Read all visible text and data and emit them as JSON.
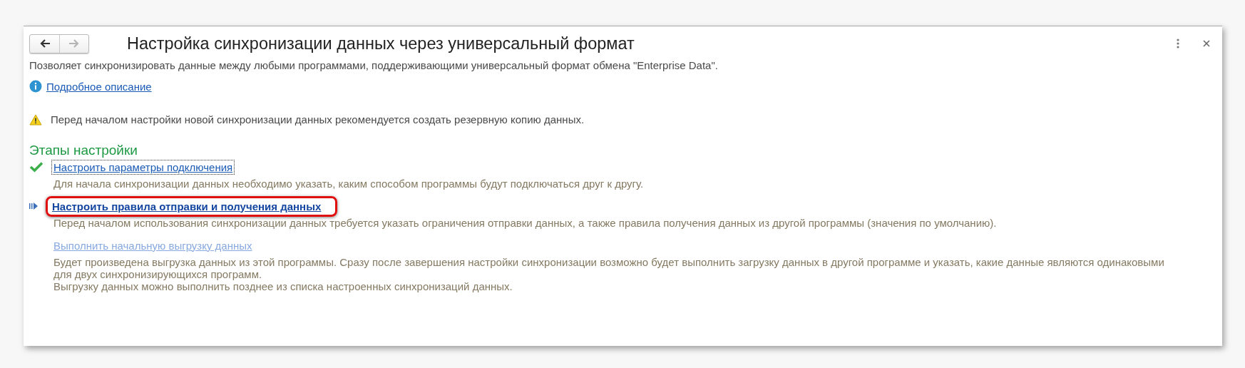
{
  "window": {
    "title": "Настройка синхронизации данных через универсальный формат",
    "nav": [
      {
        "kind": "back",
        "disabled": false
      },
      {
        "kind": "forward",
        "disabled": true
      }
    ]
  },
  "description": "Позволяет синхронизировать данные между любыми программами, поддерживающими универсальный формат обмена \"Enterprise Data\".",
  "info_link": "Подробное описание",
  "warning": "Перед началом настройки новой синхронизации данных рекомендуется создать резервную копию данных.",
  "stages": {
    "heading": "Этапы настройки",
    "steps": [
      {
        "kind": "done",
        "link": "Настроить параметры подключения",
        "focused": true,
        "highlighted": false,
        "description": [
          "Для начала синхронизации данных необходимо указать, каким способом программы будут подключаться друг к другу."
        ]
      },
      {
        "kind": "current",
        "link": "Настроить правила отправки и получения данных",
        "focused": false,
        "highlighted": true,
        "description": [
          "Перед началом использования синхронизации данных требуется указать ограничения отправки данных, а также правила получения данных из другой программы (значения по умолчанию)."
        ]
      },
      {
        "kind": "pending",
        "link": "Выполнить начальную выгрузку данных",
        "focused": false,
        "highlighted": false,
        "description": [
          "Будет произведена выгрузка данных из этой программы. Сразу после завершения настройки синхронизации возможно будет выполнить загрузку данных в другой программе и указать, какие данные являются одинаковыми для двух синхронизирующихся программ.",
          "Выгрузку данных можно выполнить позднее из списка настроенных синхронизаций данных."
        ]
      }
    ]
  }
}
